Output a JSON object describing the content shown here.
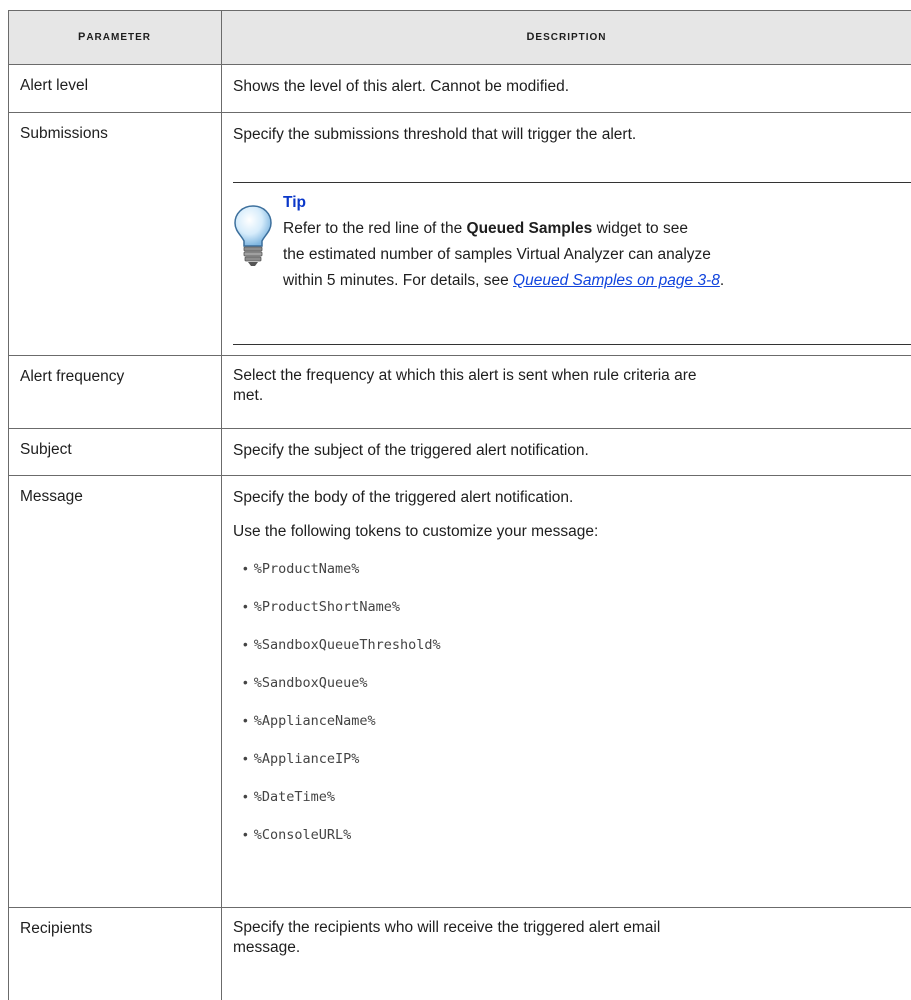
{
  "header": {
    "param": "Parameter",
    "desc": "Description"
  },
  "rows": {
    "alert_level": {
      "param": "Alert level",
      "desc": "Shows the level of this alert. Cannot be modified."
    },
    "submissions": {
      "param": "Submissions",
      "desc": "Specify the submissions threshold that will trigger the alert.",
      "tip": {
        "title": "Tip",
        "line1_pre": "Refer to the red line of the ",
        "line1_bold": "Queued Samples",
        "line1_post": " widget to see",
        "line2": "the estimated number of samples Virtual Analyzer can analyze",
        "line3_pre": "within 5 minutes. For details, see ",
        "line3_link": "Queued Samples on page 3-8",
        "line3_post": "."
      }
    },
    "alert_frequency": {
      "param": "Alert frequency",
      "desc_line1": "Select the frequency at which this alert is sent when rule criteria are",
      "desc_line2": "met."
    },
    "subject": {
      "param": "Subject",
      "desc": "Specify the subject of the triggered alert notification."
    },
    "message": {
      "param": "Message",
      "desc": "Specify the body of the triggered alert notification.",
      "tokens_intro": "Use the following tokens to customize your message:",
      "tokens": [
        "%ProductName%",
        "%ProductShortName%",
        "%SandboxQueueThreshold%",
        "%SandboxQueue%",
        "%ApplianceName%",
        "%ApplianceIP%",
        "%DateTime%",
        "%ConsoleURL%"
      ]
    },
    "recipients": {
      "param": "Recipients",
      "desc_line1": "Specify the recipients who will receive the triggered alert email",
      "desc_line2": "message."
    }
  },
  "icons": {
    "tip": "lightbulb-icon",
    "bullet": "bullet-dot-icon"
  }
}
